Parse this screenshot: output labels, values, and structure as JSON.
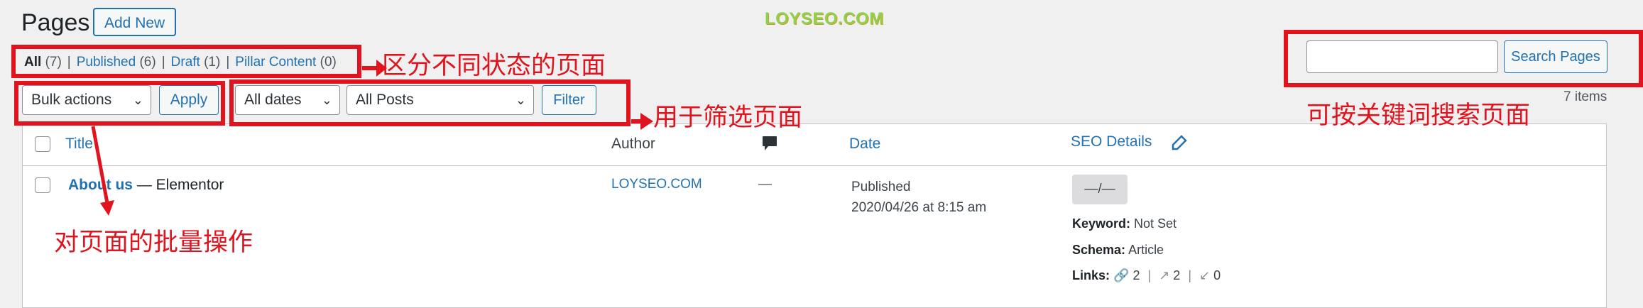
{
  "header": {
    "title": "Pages",
    "add_new_label": "Add New",
    "watermark": "LOYSEO.COM"
  },
  "status_filters": [
    {
      "label": "All",
      "count": "(7)",
      "current": true
    },
    {
      "label": "Published",
      "count": "(6)",
      "current": false
    },
    {
      "label": "Draft",
      "count": "(1)",
      "current": false
    },
    {
      "label": "Pillar Content",
      "count": "(0)",
      "current": false
    }
  ],
  "separator": "|",
  "search": {
    "value": "",
    "placeholder": "",
    "button_label": "Search Pages"
  },
  "bulk": {
    "selected": "Bulk actions",
    "apply_label": "Apply"
  },
  "filters": {
    "dates_selected": "All dates",
    "posts_selected": "All Posts",
    "filter_label": "Filter"
  },
  "items_count": "7 items",
  "table": {
    "columns": {
      "title": "Title",
      "author": "Author",
      "date": "Date",
      "seo": "SEO Details"
    },
    "rows": [
      {
        "title": "About us",
        "state": "— Elementor",
        "author": "LOYSEO.COM",
        "comments": "—",
        "date_status": "Published",
        "date_value": "2020/04/26 at 8:15 am",
        "seo_score": "—/—",
        "keyword_label": "Keyword:",
        "keyword_value": "Not Set",
        "schema_label": "Schema:",
        "schema_value": "Article",
        "links_label": "Links:",
        "links_internal": "2",
        "links_external": "2",
        "links_incoming": "0"
      }
    ]
  },
  "annotations": {
    "status": "区分不同状态的页面",
    "filter": "用于筛选页面",
    "search": "可按关键词搜索页面",
    "bulk": "对页面的批量操作"
  },
  "colors": {
    "annotation_red": "#e0141e",
    "wp_blue": "#2271b1",
    "watermark_green": "#8fd14f"
  }
}
